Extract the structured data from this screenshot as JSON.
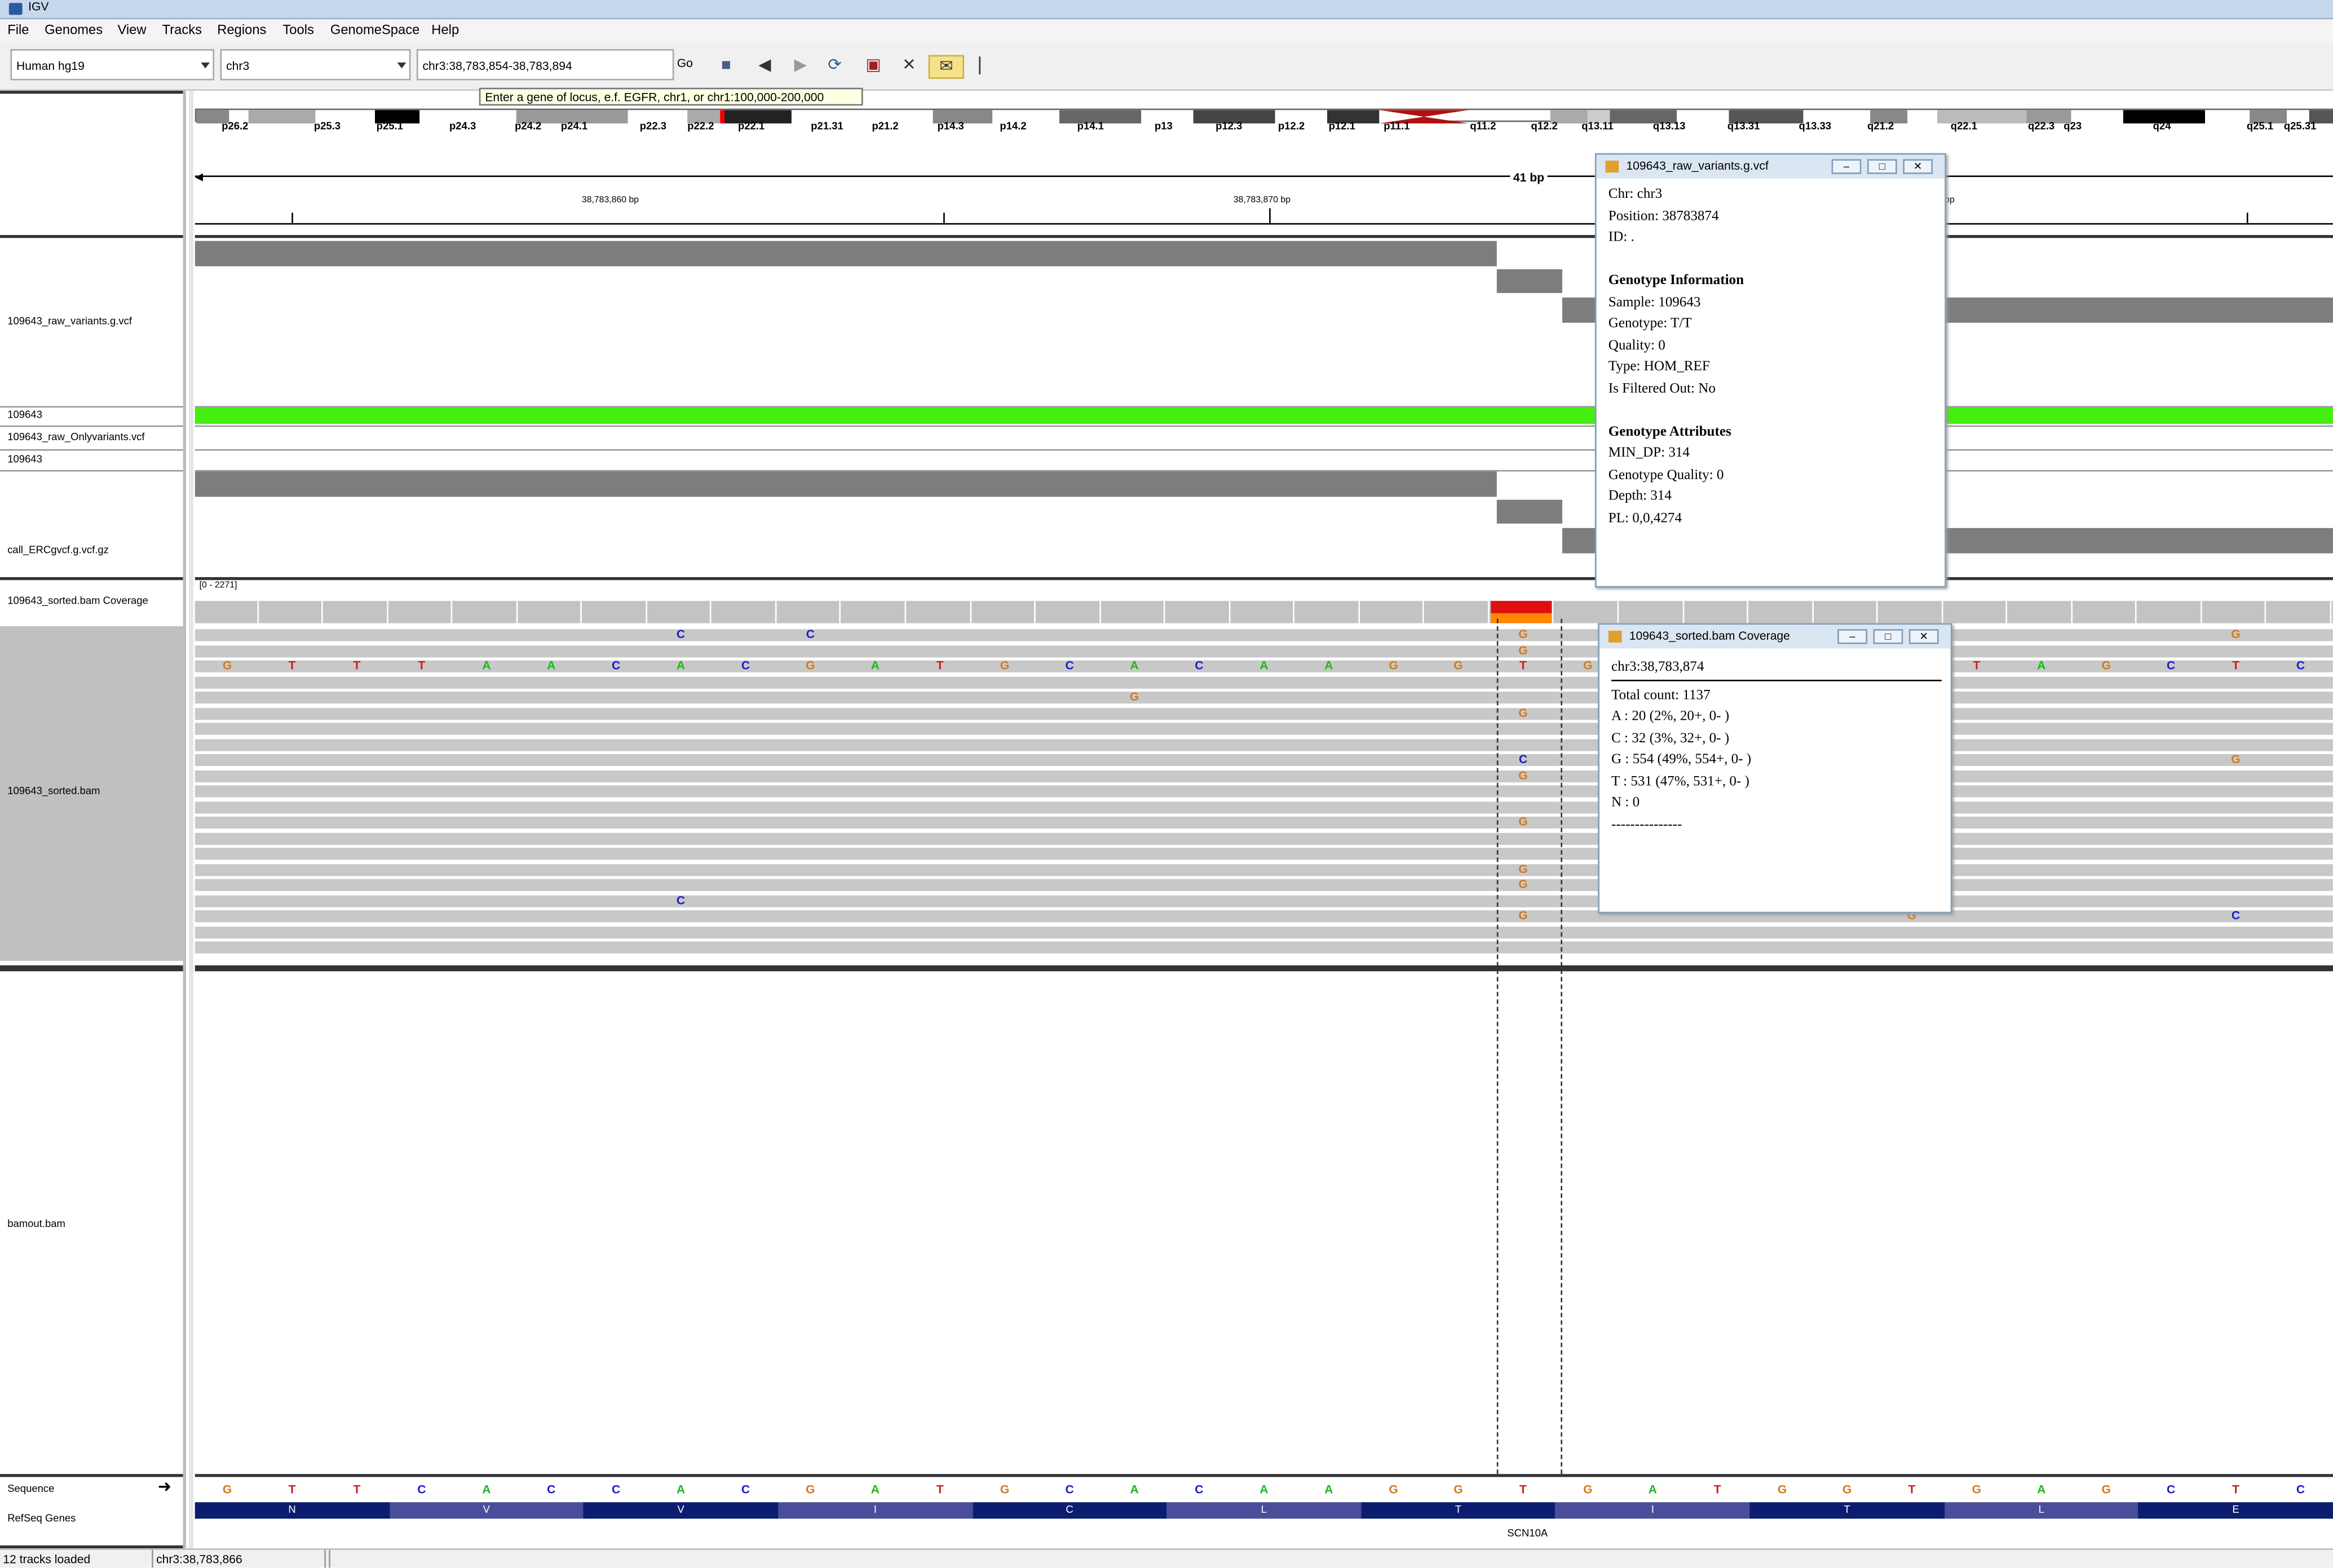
{
  "window": {
    "title": "IGV"
  },
  "menu": [
    "File",
    "Genomes",
    "View",
    "Tracks",
    "Regions",
    "Tools",
    "GenomeSpace",
    "Help"
  ],
  "toolbar": {
    "genome": "Human hg19",
    "chromosome": "chr3",
    "locus": "chr3:38,783,854-38,783,894",
    "go_label": "Go",
    "tooltip": "Enter a gene of locus, e.f. EGFR,   chr1,   or chr1:100,000-200,000"
  },
  "ideogram": {
    "bands": [
      "p26.2",
      "p25.3",
      "p25.1",
      "p24.3",
      "p24.2",
      "p24.1",
      "p22.3",
      "p22.2",
      "p22.1",
      "p21.31",
      "p21.2",
      "p14.3",
      "p14.2",
      "p14.1",
      "p13",
      "p12.3",
      "p12.2",
      "p12.1",
      "p11.1",
      "q11.2",
      "q12.2",
      "q13.11",
      "q13.13",
      "q13.31",
      "q13.33",
      "q21.2",
      "q22.1",
      "q22.3",
      "q23",
      "q24",
      "q25.1",
      "q25.31"
    ]
  },
  "ruler": {
    "span": "41 bp",
    "tick1": "38,783,860 bp",
    "tick2": "38,783,870 bp",
    "tick3": "bp"
  },
  "tracks": {
    "raw_vcf": "109643_raw_variants.g.vcf",
    "sample1": "109643",
    "only_vcf": "109643_raw_Onlyvariants.vcf",
    "sample2": "109643",
    "erc_vcf": "call_ERCgvcf.g.vcf.gz",
    "coverage": "109643_sorted.bam Coverage",
    "coverage_range": "[0 - 2271]",
    "bam": "109643_sorted.bam",
    "bamout": "bamout.bam",
    "sequence": "Sequence",
    "refseq": "RefSeq Genes",
    "gene": "SCN10A"
  },
  "sequence": [
    "G",
    "T",
    "T",
    "C",
    "A",
    "C",
    "C",
    "A",
    "C",
    "G",
    "A",
    "T",
    "G",
    "C",
    "A",
    "C",
    "A",
    "A",
    "G",
    "G",
    "T",
    "G",
    "A",
    "T",
    "G",
    "G",
    "T",
    "G",
    "A",
    "G",
    "C",
    "T",
    "C"
  ],
  "read_row": [
    "G",
    "T",
    "T",
    "T",
    "A",
    "A",
    "C",
    "A",
    "C",
    "G",
    "A",
    "T",
    "G",
    "C",
    "A",
    "C",
    "A",
    "A",
    "G",
    "G",
    "T",
    "G",
    "",
    "",
    "",
    "",
    "",
    "T",
    "A",
    "G",
    "C",
    "T",
    "C"
  ],
  "amino_acids": [
    "N",
    "V",
    "V",
    "I",
    "C",
    "L",
    "T",
    "I",
    "T",
    "L",
    "E"
  ],
  "popup_vcf": {
    "title": "109643_raw_variants.g.vcf",
    "chr": "Chr: chr3",
    "position": "Position: 38783874",
    "id": "ID: .",
    "gi_header": "Genotype Information",
    "sample": "Sample: 109643",
    "genotype": "Genotype: T/T",
    "quality": "Quality: 0",
    "type": "Type: HOM_REF",
    "filtered": "Is Filtered Out: No",
    "ga_header": "Genotype Attributes",
    "min_dp": "MIN_DP: 314",
    "gq": "Genotype Quality: 0",
    "depth": "Depth: 314",
    "pl": "PL: 0,0,4274"
  },
  "popup_cov": {
    "title": "109643_sorted.bam Coverage",
    "locus": "chr3:38,783,874",
    "total": "Total count: 1137",
    "a": "A : 20 (2%, 20+, 0- )",
    "c": "C : 32 (3%, 32+, 0- )",
    "g": "G : 554 (49%, 554+, 0- )",
    "t": "T : 531 (47%, 531+, 0- )",
    "n": "N : 0",
    "dash": "---------------"
  },
  "status": {
    "tracks_loaded": "12 tracks loaded",
    "position": "chr3:38,783,866"
  },
  "colors": {
    "A": "#1eb81e",
    "C": "#1a1acc",
    "G": "#d27a1e",
    "T": "#d01e1e",
    "green_bar": "#44ee11",
    "gene_dark": "#0b1d6e",
    "gene_light": "#4a4e9a"
  }
}
